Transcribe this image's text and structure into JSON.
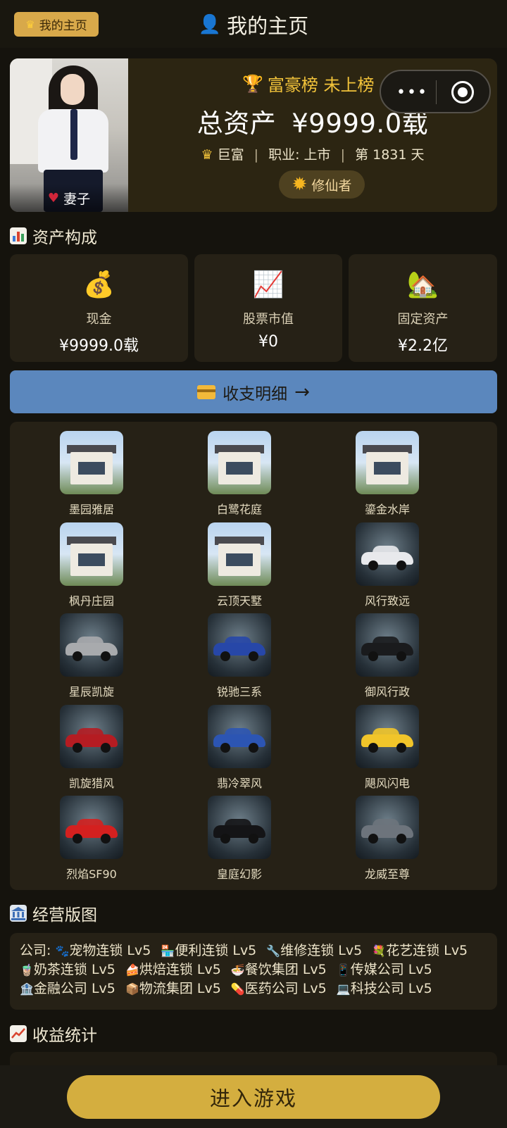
{
  "header": {
    "badge_label": "我的主页",
    "badge_icon": "crown-icon",
    "title": "我的主页",
    "title_icon": "person-icon"
  },
  "profile": {
    "avatar_caption": "妻子",
    "rank_label": "富豪榜 未上榜",
    "total_label": "总资产",
    "total_value": "¥9999.0载",
    "status": "巨富",
    "job": "职业: 上市",
    "day": "第 1831 天",
    "title_badge": "修仙者"
  },
  "assets": {
    "heading": "资产构成",
    "cards": [
      {
        "icon": "💰",
        "label": "现金",
        "value": "¥9999.0载"
      },
      {
        "icon": "📈",
        "label": "股票市值",
        "value": "¥0"
      },
      {
        "icon": "🏡",
        "label": "固定资产",
        "value": "¥2.2亿"
      }
    ]
  },
  "income_button": {
    "label": "收支明细",
    "arrow": "→"
  },
  "properties": [
    {
      "name": "墨园雅居",
      "type": "house"
    },
    {
      "name": "白鹭花庭",
      "type": "house"
    },
    {
      "name": "鎏金水岸",
      "type": "house"
    },
    {
      "name": "枫丹庄园",
      "type": "house"
    },
    {
      "name": "云顶天墅",
      "type": "house"
    },
    {
      "name": "风行致远",
      "type": "car",
      "color": "#e8e9ec"
    },
    {
      "name": "星辰凯旋",
      "type": "car",
      "color": "#a8aaad"
    },
    {
      "name": "锐驰三系",
      "type": "car",
      "color": "#2747a8"
    },
    {
      "name": "御风行政",
      "type": "car",
      "color": "#1a1b1d"
    },
    {
      "name": "凯旋猎风",
      "type": "car",
      "color": "#b51c22"
    },
    {
      "name": "翡冷翠风",
      "type": "car",
      "color": "#2c55b3"
    },
    {
      "name": "飓风闪电",
      "type": "car",
      "color": "#f1c52a"
    },
    {
      "name": "烈焰SF90",
      "type": "car",
      "color": "#d4201f"
    },
    {
      "name": "皇庭幻影",
      "type": "car",
      "color": "#141416"
    },
    {
      "name": "龙威至尊",
      "type": "car",
      "color": "#6d747c"
    }
  ],
  "business": {
    "heading": "经营版图",
    "prefix": "公司:",
    "companies": [
      {
        "icon": "🐾",
        "text": "宠物连锁 Lv5"
      },
      {
        "icon": "🏪",
        "text": "便利连锁 Lv5"
      },
      {
        "icon": "🔧",
        "text": "维修连锁 Lv5"
      },
      {
        "icon": "💐",
        "text": "花艺连锁 Lv5"
      },
      {
        "icon": "🧋",
        "text": "奶茶连锁 Lv5"
      },
      {
        "icon": "🍰",
        "text": "烘焙连锁 Lv5"
      },
      {
        "icon": "🍜",
        "text": "餐饮集团 Lv5"
      },
      {
        "icon": "📱",
        "text": "传媒公司 Lv5"
      },
      {
        "icon": "🏦",
        "text": "金融公司 Lv5"
      },
      {
        "icon": "📦",
        "text": "物流集团 Lv5"
      },
      {
        "icon": "💊",
        "text": "医药公司 Lv5"
      },
      {
        "icon": "💻",
        "text": "科技公司 Lv5"
      }
    ]
  },
  "stats": {
    "heading": "收益统计"
  },
  "footer": {
    "enter_label": "进入游戏"
  },
  "colors": {
    "background": "#15130d",
    "card": "#262116",
    "accent_gold": "#d4ae3f",
    "income_button": "#5b87bd"
  }
}
